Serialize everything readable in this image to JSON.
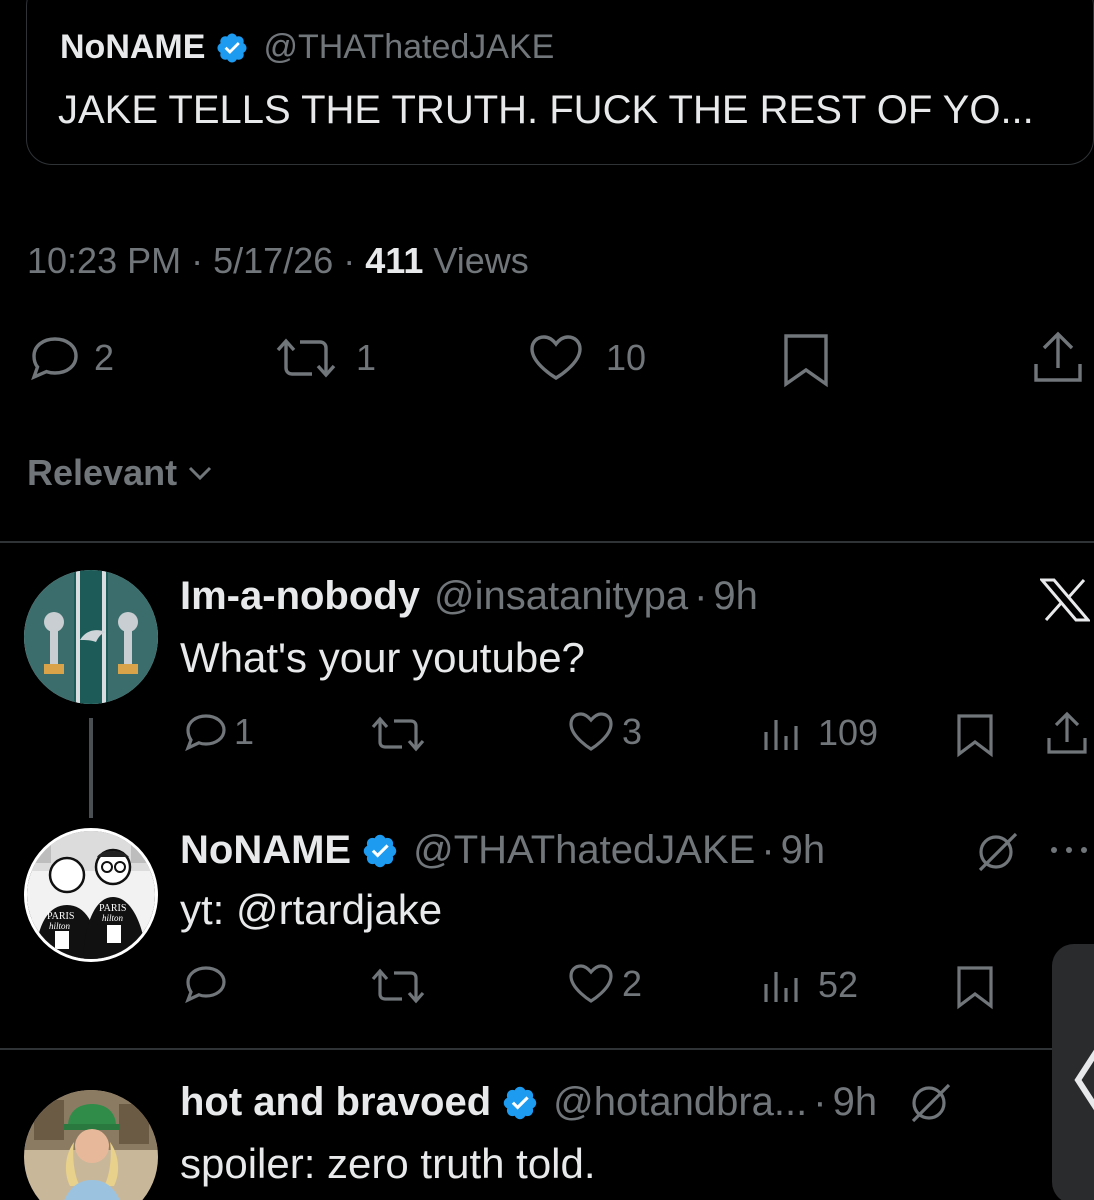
{
  "quote": {
    "name": "NoNAME",
    "handle": "@THAThatedJAKE",
    "text": "JAKE TELLS THE TRUTH. FUCK THE REST OF YO..."
  },
  "tweet_meta": {
    "time": "10:23 PM",
    "date": "5/17/26",
    "views_count": "411",
    "views_label": "Views",
    "sep": "·"
  },
  "actions": {
    "replies": "2",
    "reposts": "1",
    "likes": "10"
  },
  "sort": {
    "label": "Relevant"
  },
  "replies": [
    {
      "name": "Im-a-nobody",
      "handle": "@insatanitypa",
      "time": "9h",
      "text": "What's your youtube?",
      "replies": "1",
      "reposts": "",
      "likes": "3",
      "views": "109",
      "verified": false
    },
    {
      "name": "NoNAME",
      "handle": "@THAThatedJAKE",
      "time": "9h",
      "text": "yt: @rtardjake",
      "replies": "",
      "reposts": "",
      "likes": "2",
      "views": "52",
      "verified": true
    },
    {
      "name": "hot and bravoed",
      "handle": "@hotandbra...",
      "time": "9h",
      "text": "spoiler: zero truth told.",
      "verified": true
    }
  ],
  "avatar_text": {
    "paris_1": "PARIS",
    "hilton_1": "hilton",
    "paris_2": "PARIS",
    "hilton_2": "hilton"
  },
  "colors": {
    "background": "#000000",
    "text": "#e7e9ea",
    "muted": "#71767b",
    "verified": "#1d9bf0",
    "divider": "#2f3336"
  }
}
